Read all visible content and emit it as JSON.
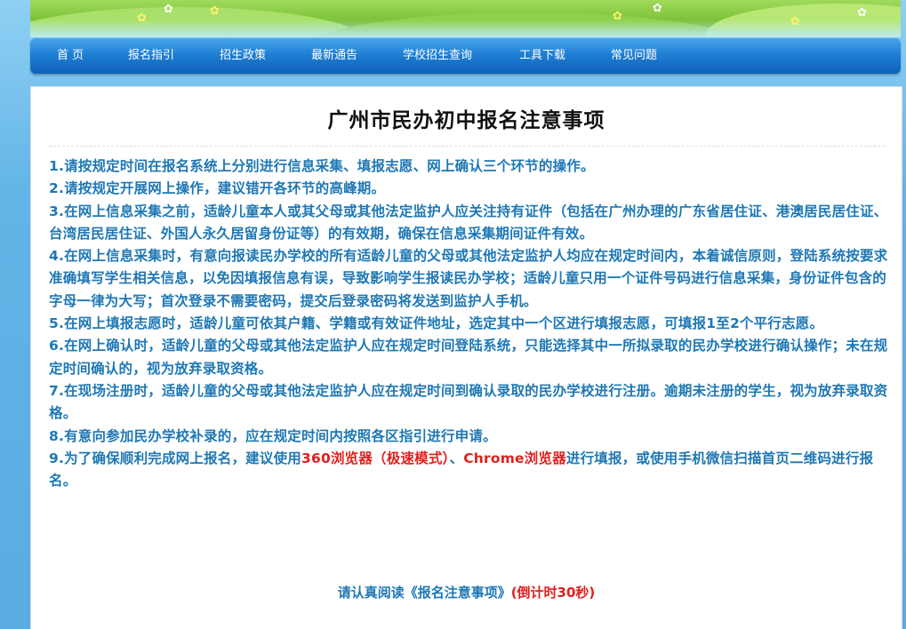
{
  "nav": {
    "items": [
      "首 页",
      "报名指引",
      "招生政策",
      "最新通告",
      "学校招生查询",
      "工具下载",
      "常见问题"
    ]
  },
  "page": {
    "title": "广州市民办初中报名注意事项"
  },
  "notes": [
    {
      "text": "1.请按规定时间在报名系统上分别进行信息采集、填报志愿、网上确认三个环节的操作。"
    },
    {
      "text": "2.请按规定开展网上操作，建议错开各环节的高峰期。"
    },
    {
      "text": "3.在网上信息采集之前，适龄儿童本人或其父母或其他法定监护人应关注持有证件（包括在广州办理的广东省居住证、港澳居民居住证、台湾居民居住证、外国人永久居留身份证等）的有效期，确保在信息采集期间证件有效。"
    },
    {
      "text": "4.在网上信息采集时，有意向报读民办学校的所有适龄儿童的父母或其他法定监护人均应在规定时间内，本着诚信原则，登陆系统按要求准确填写学生相关信息，以免因填报信息有误，导致影响学生报读民办学校；适龄儿童只用一个证件号码进行信息采集，身份证件包含的字母一律为大写；首次登录不需要密码，提交后登录密码将发送到监护人手机。"
    },
    {
      "text": "5.在网上填报志愿时，适龄儿童可依其户籍、学籍或有效证件地址，选定其中一个区进行填报志愿，可填报1至2个平行志愿。"
    },
    {
      "text": "6.在网上确认时，适龄儿童的父母或其他法定监护人应在规定时间登陆系统，只能选择其中一所拟录取的民办学校进行确认操作；未在规定时间确认的，视为放弃录取资格。"
    },
    {
      "text": "7.在现场注册时，适龄儿童的父母或其他法定监护人应在规定时间到确认录取的民办学校进行注册。逾期未注册的学生，视为放弃录取资格。"
    },
    {
      "text": "8.有意向参加民办学校补录的，应在规定时间内按照各区指引进行申请。"
    }
  ],
  "note9": {
    "prefix": "9.为了确保顺利完成网上报名，建议使用",
    "browser1": "360浏览器（极速模式）",
    "sep": "、",
    "browser2": "Chrome浏览器",
    "suffix": "进行填报，或使用手机微信扫描首页二维码进行报名。"
  },
  "footer": {
    "read_text": "请认真阅读《报名注意事项》",
    "countdown": "(倒计时30秒)"
  },
  "colors": {
    "text_blue": "#1e78b4",
    "highlight_red": "#e0201e",
    "nav_blue": "#1f7fd4"
  }
}
